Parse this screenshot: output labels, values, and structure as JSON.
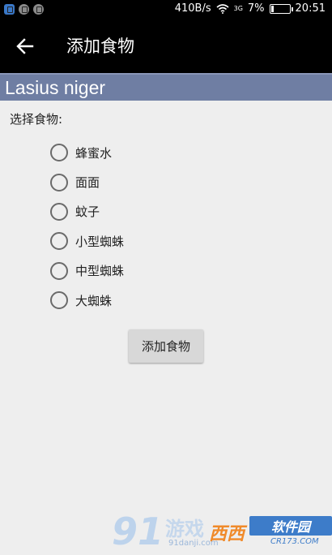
{
  "status_bar": {
    "net_speed": "410B/s",
    "signal_label": "3G",
    "battery": "7%",
    "time": "20:51"
  },
  "action_bar": {
    "title": "添加食物",
    "back_icon": "arrow-left-icon"
  },
  "header": {
    "title": "Lasius niger",
    "color": "#6f7ea3"
  },
  "form": {
    "prompt": "选择食物:",
    "options": [
      {
        "label": "蜂蜜水",
        "selected": false
      },
      {
        "label": "面面",
        "selected": false
      },
      {
        "label": "蚊子",
        "selected": false
      },
      {
        "label": "小型蜘蛛",
        "selected": false
      },
      {
        "label": "中型蜘蛛",
        "selected": false
      },
      {
        "label": "大蜘蛛",
        "selected": false
      }
    ],
    "submit_label": "添加食物"
  },
  "watermark": {
    "brand_number": "91",
    "brand_text": "游戏",
    "brand_url": "91danji.com",
    "xixi": "西西",
    "software_park": "软件园",
    "cr_url": "CR173.COM"
  }
}
